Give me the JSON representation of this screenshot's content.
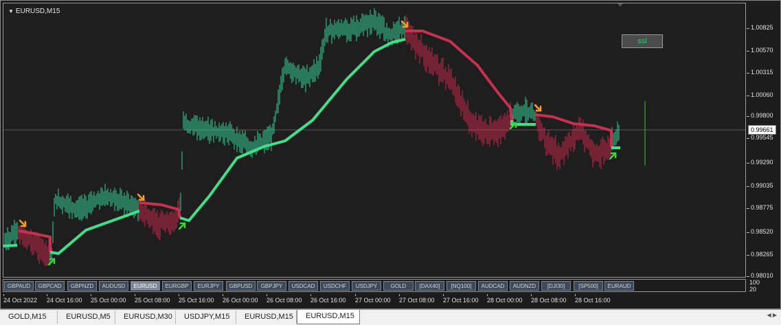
{
  "chart": {
    "title": "EURUSD,M15",
    "current_price": "0.99661",
    "indicator_button": "ssl",
    "colors": {
      "background": "#1e1e1e",
      "bull_candle": "#35d49b",
      "bear_candle": "#c8284b",
      "ssl_up_line": "#3fe08a",
      "ssl_down_line": "#c8304f",
      "down_arrow": "#f5a020",
      "up_arrow": "#38d83a"
    },
    "price_levels": [
      "1.00825",
      "1.00570",
      "1.00315",
      "1.00060",
      "0.99800",
      "0.99545",
      "0.99290",
      "0.99035",
      "0.98775",
      "0.98520",
      "0.98265",
      "0.98010"
    ],
    "volume_axis": [
      "100",
      "20"
    ],
    "time_labels": [
      "24 Oct 2022",
      "24 Oct 16:00",
      "25 Oct 00:00",
      "25 Oct 08:00",
      "25 Oct 16:00",
      "26 Oct 00:00",
      "26 Oct 08:00",
      "26 Oct 16:00",
      "27 Oct 00:00",
      "27 Oct 08:00",
      "27 Oct 16:00",
      "28 Oct 00:00",
      "28 Oct 08:00",
      "28 Oct 16:00"
    ]
  },
  "symbol_bar": [
    "GBPAUD",
    "GBPCAD",
    "GBPNZD",
    "AUDUSD",
    "EURUSD",
    "EURGBP",
    "EURJPY",
    "GBPUSD",
    "GBPJPY",
    "USDCAD",
    "USDCHF",
    "USDJPY",
    "GOLD",
    "[DAX40]",
    "[NQ100]",
    "AUDCAD",
    "AUDNZD",
    "[DJI30]",
    "[SP500]",
    "EURAUD"
  ],
  "active_symbol": "EURUSD",
  "tabs": [
    "GOLD,M15",
    "EURUSD,M5",
    "EURUSD,M30",
    "USDJPY,M15",
    "EURUSD,M15",
    "EURUSD,M15"
  ],
  "active_tab_index": 5
}
